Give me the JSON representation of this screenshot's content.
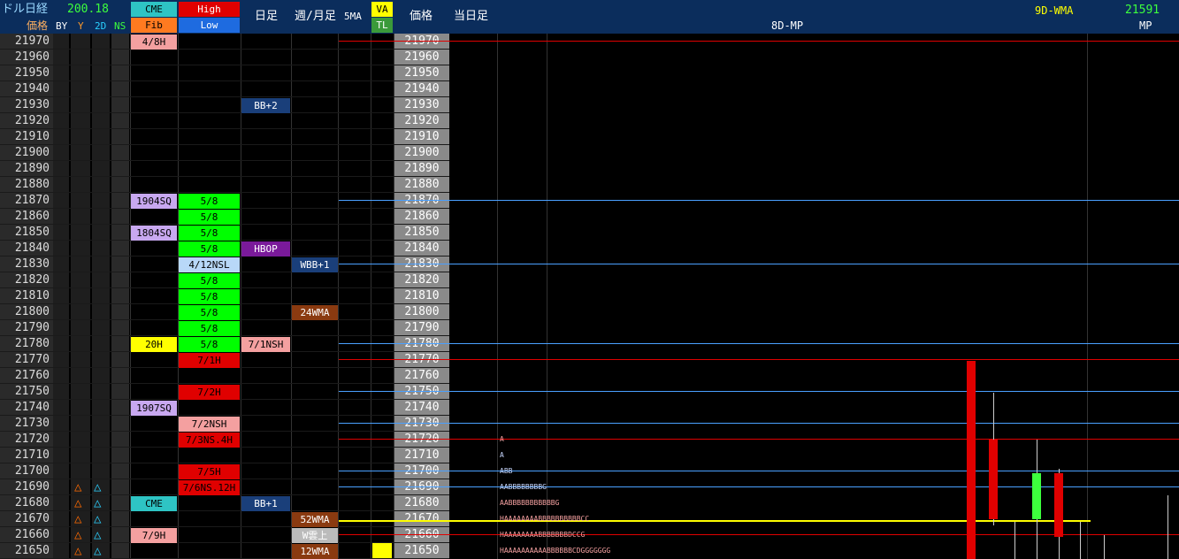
{
  "header": {
    "title": "ドル日経",
    "price_label": "価格",
    "value": "200.18",
    "sub_labels": [
      "BY",
      "Y",
      "2D",
      "NS"
    ],
    "cme": "CME",
    "fib": "Fib",
    "high": "High",
    "low": "Low",
    "daily": "日足",
    "weekly": "週/月足",
    "ma5": "5MA",
    "va": "VA",
    "tl": "TL",
    "price2": "価格",
    "today": "当日足",
    "mp8d": "8D-MP",
    "wma9d": "9D-WMA",
    "mp_value": "21591",
    "mp": "MP"
  },
  "prices": [
    "21970",
    "21960",
    "21950",
    "21940",
    "21930",
    "21920",
    "21910",
    "21900",
    "21890",
    "21880",
    "21870",
    "21860",
    "21850",
    "21840",
    "21830",
    "21820",
    "21810",
    "21800",
    "21790",
    "21780",
    "21770",
    "21760",
    "21750",
    "21740",
    "21730",
    "21720",
    "21710",
    "21700",
    "21690",
    "21680",
    "21670",
    "21660",
    "21650"
  ],
  "colors": {
    "header": "#0b2d5c",
    "green": "#00ff00",
    "red": "#e00000",
    "pink": "#f4a0a0",
    "lavender": "#c8a8f0",
    "cyan": "#2ec4c4",
    "blue": "#1a3f7a",
    "purple": "#7a1a9a",
    "brown": "#8a3a10",
    "yellow": "#ffff00",
    "orange_tri": "#ff6a00",
    "cyan_tri": "#2ad0ff"
  },
  "cells": {
    "fib": [
      {
        "row": 0,
        "text": "4/8H",
        "bg": "#f4a0a0",
        "fg": "#000"
      },
      {
        "row": 10,
        "text": "1904SQ",
        "bg": "#c8a8f0",
        "fg": "#000"
      },
      {
        "row": 12,
        "text": "1804SQ",
        "bg": "#c8a8f0",
        "fg": "#000"
      },
      {
        "row": 19,
        "text": "20H",
        "bg": "#ffff00",
        "fg": "#000"
      },
      {
        "row": 23,
        "text": "1907SQ",
        "bg": "#c8a8f0",
        "fg": "#000"
      },
      {
        "row": 29,
        "text": "CME",
        "bg": "#2ec4c4",
        "fg": "#000"
      },
      {
        "row": 31,
        "text": "7/9H",
        "bg": "#f4a0a0",
        "fg": "#000"
      }
    ],
    "hilo": [
      {
        "row": 10,
        "text": "5/8",
        "bg": "#00ff00",
        "fg": "#000"
      },
      {
        "row": 11,
        "text": "5/8",
        "bg": "#00ff00",
        "fg": "#000"
      },
      {
        "row": 12,
        "text": "5/8",
        "bg": "#00ff00",
        "fg": "#000"
      },
      {
        "row": 13,
        "text": "5/8",
        "bg": "#00ff00",
        "fg": "#000"
      },
      {
        "row": 14,
        "text": "4/12NSL",
        "bg": "#b8d8f8",
        "fg": "#000"
      },
      {
        "row": 15,
        "text": "5/8",
        "bg": "#00ff00",
        "fg": "#000"
      },
      {
        "row": 16,
        "text": "5/8",
        "bg": "#00ff00",
        "fg": "#000"
      },
      {
        "row": 17,
        "text": "5/8",
        "bg": "#00ff00",
        "fg": "#000"
      },
      {
        "row": 18,
        "text": "5/8",
        "bg": "#00ff00",
        "fg": "#000"
      },
      {
        "row": 19,
        "text": "5/8",
        "bg": "#00ff00",
        "fg": "#000"
      },
      {
        "row": 20,
        "text": "7/1H",
        "bg": "#e00000",
        "fg": "#000"
      },
      {
        "row": 22,
        "text": "7/2H",
        "bg": "#e00000",
        "fg": "#000"
      },
      {
        "row": 24,
        "text": "7/2NSH",
        "bg": "#f4a0a0",
        "fg": "#000"
      },
      {
        "row": 25,
        "text": "7/3NS.4H",
        "bg": "#e00000",
        "fg": "#000"
      },
      {
        "row": 27,
        "text": "7/5H",
        "bg": "#e00000",
        "fg": "#000"
      },
      {
        "row": 28,
        "text": "7/6NS.12H",
        "bg": "#e00000",
        "fg": "#000"
      }
    ],
    "daily": [
      {
        "row": 4,
        "text": "BB+2",
        "bg": "#1a3f7a",
        "fg": "#fff"
      },
      {
        "row": 13,
        "text": "HBOP",
        "bg": "#7a1a9a",
        "fg": "#fff"
      },
      {
        "row": 19,
        "text": "7/1NSH",
        "bg": "#f4a0a0",
        "fg": "#000"
      },
      {
        "row": 29,
        "text": "BB+1",
        "bg": "#1a3f7a",
        "fg": "#fff"
      }
    ],
    "weekly": [
      {
        "row": 14,
        "text": "WBB+1",
        "bg": "#1a3f7a",
        "fg": "#fff"
      },
      {
        "row": 17,
        "text": "24WMA",
        "bg": "#8a3a10",
        "fg": "#fff"
      },
      {
        "row": 30,
        "text": "52WMA",
        "bg": "#8a3a10",
        "fg": "#fff"
      },
      {
        "row": 31,
        "text": "W雲上",
        "bg": "#bbbbbb",
        "fg": "#fff"
      },
      {
        "row": 32,
        "text": "12WMA",
        "bg": "#8a3a10",
        "fg": "#fff"
      }
    ]
  },
  "triangles": {
    "rows": [
      28,
      29,
      30,
      31,
      32
    ],
    "glyph": "△"
  },
  "tpo": [
    {
      "row": 25,
      "text": "A",
      "color": "#f4a0a0"
    },
    {
      "row": 26,
      "text": "A",
      "color": "#c8d8ff"
    },
    {
      "row": 27,
      "text": "ABB",
      "color": "#c8d8ff"
    },
    {
      "row": 28,
      "text": "AABBBBBBBBG",
      "color": "#c8d8ff"
    },
    {
      "row": 29,
      "text": "AABBBBBBBBBBBG",
      "color": "#f4a0a0"
    },
    {
      "row": 30,
      "text": "HAAAAAAAABBBBBBBBBBCC",
      "color": "#f4a0a0"
    },
    {
      "row": 31,
      "text": "HAAAAAAAABBBBBBBDCCG",
      "color": "#f4a0a0"
    },
    {
      "row": 32,
      "text": "HAAAAAAAAAABBBBBBCDGGGGGGG",
      "color": "#f4a0a0"
    }
  ]
}
